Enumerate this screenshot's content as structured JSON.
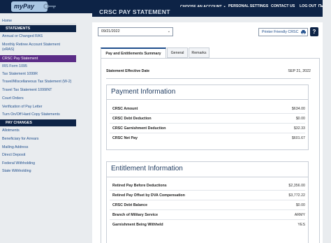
{
  "header": {
    "logo": "myPay",
    "nav": [
      {
        "label": "Choose an Account",
        "caret": true
      },
      {
        "label": "Personal Settings"
      },
      {
        "label": "Contact Us"
      },
      {
        "label": "Log Out",
        "icon": "logout-icon"
      }
    ]
  },
  "sidebar": {
    "home": "Home",
    "statements_header": "STATEMENTS",
    "statements": [
      "Annual or Changed RAS",
      "Monthly Retiree Account Statement",
      "(eRAS)",
      "CRSC Pay Statement",
      "IRS Form 1095",
      "Tax Statement 1099R",
      "Travel/Miscellaneous Tax Statement (W-2)",
      "Travel Tax Statement 1099INT",
      "Court Orders",
      "Verification of Pay Letter",
      "Turn On/Off Hard Copy Statements"
    ],
    "pay_changes_header": "PAY CHANGES",
    "pay_changes": [
      "Allotments",
      "Beneficiary for Arrears",
      "Mailing Address",
      "Direct Deposit",
      "Federal Withholding",
      "State Withholding"
    ]
  },
  "page": {
    "title": "CRSC Pay Statement",
    "date_value": "09/21/2022",
    "printer_label": "Printer Friendly CRSC",
    "help_label": "?"
  },
  "tabs": [
    "Pay and Entitlements Summary",
    "General",
    "Remarks"
  ],
  "statement": {
    "effective_label": "Statement Effective Date",
    "effective_value": "SEP 21, 2022"
  },
  "payment": {
    "title": "Payment Information",
    "rows": [
      {
        "label": "CRSC Amount",
        "value": "$634.00"
      },
      {
        "label": "CRSC Debt Deduction",
        "value": "$0.00"
      },
      {
        "label": "CRSC Garnishment Deduction",
        "value": "$32.33"
      },
      {
        "label": "CRSC Net Pay",
        "value": "$601.67"
      }
    ]
  },
  "entitlement": {
    "title": "Entitlement Information",
    "rows": [
      {
        "label": "Retired Pay Before Deductions",
        "value": "$2,356.00"
      },
      {
        "label": "Retired Pay Offset by DVA Compensation",
        "value": "$3,772.22"
      },
      {
        "label": "CRSC Debt Balance",
        "value": "$0.00"
      },
      {
        "label": "Branch of Military Service",
        "value": "ARMY"
      },
      {
        "label": "Garnishment Being Withheld",
        "value": "YES"
      }
    ]
  },
  "colors": {
    "navy": "#0d2346",
    "active_purple": "#5b2c87",
    "link_blue": "#1f4e8c"
  }
}
